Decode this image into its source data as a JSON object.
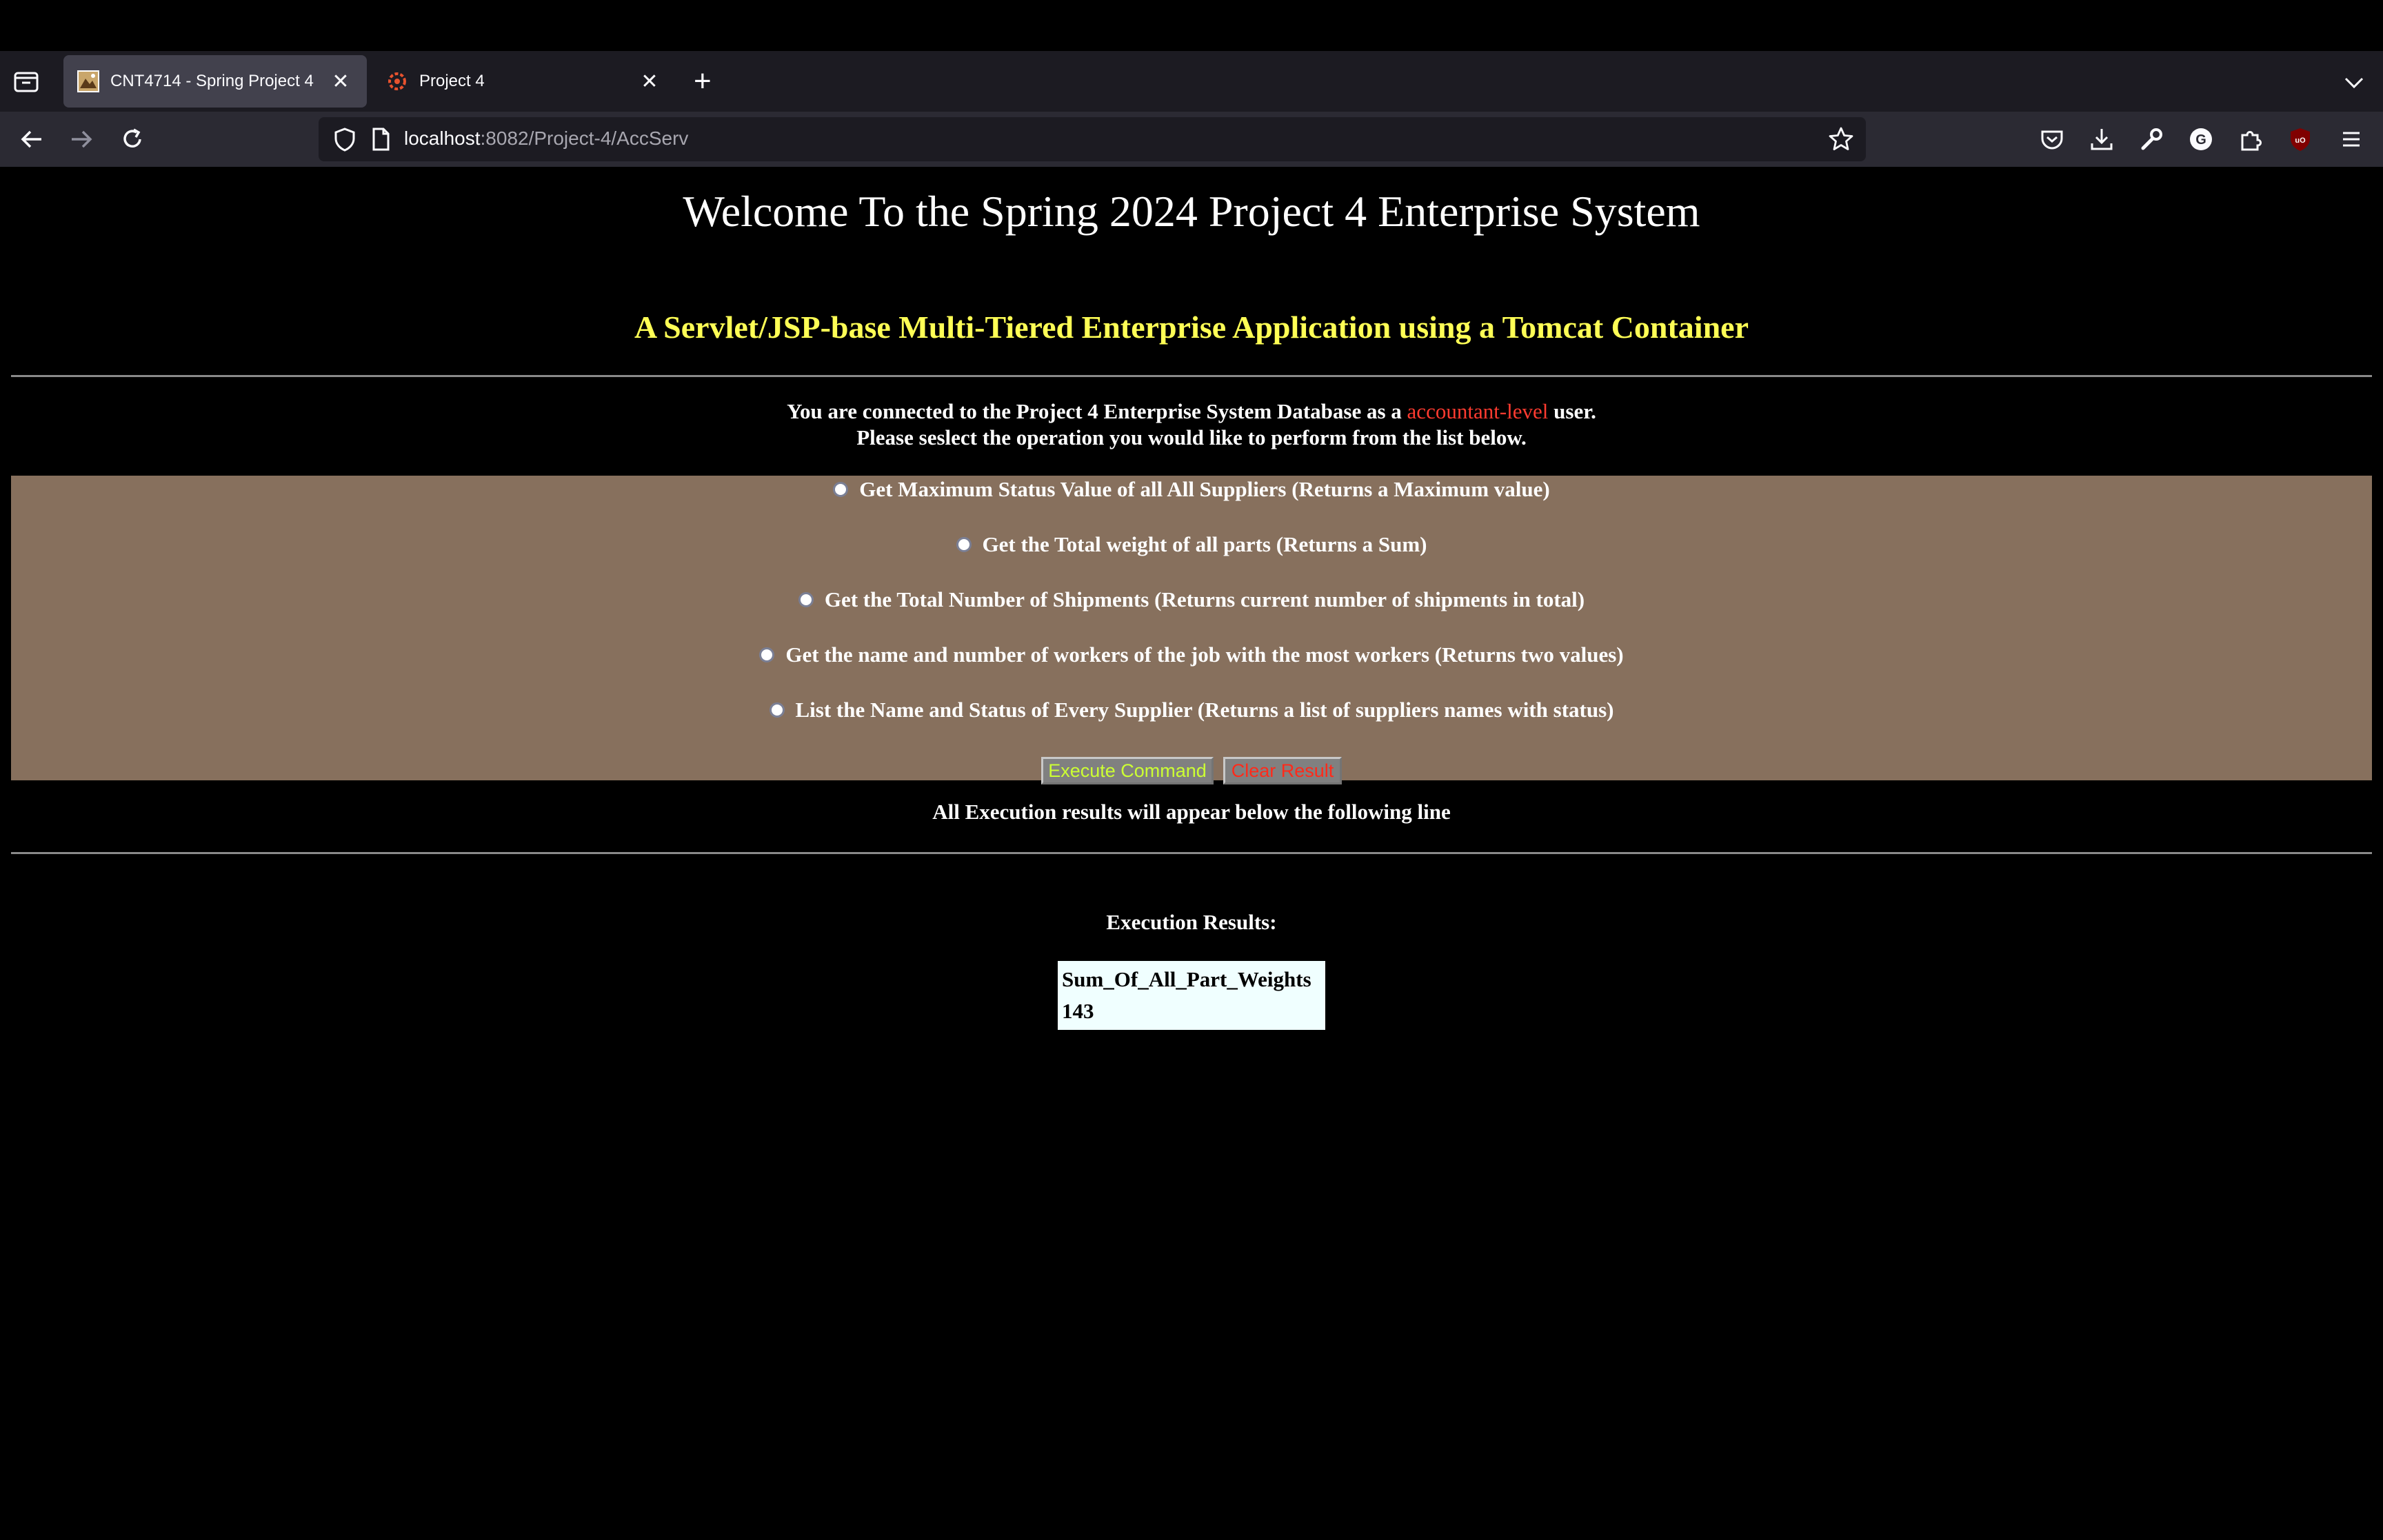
{
  "browser": {
    "tabs": [
      {
        "title": "CNT4714 - Spring Project 4",
        "active": true
      },
      {
        "title": "Project 4",
        "active": false
      }
    ],
    "url": {
      "host": "localhost",
      "rest": ":8082/Project-4/AccServ"
    }
  },
  "page": {
    "heading": "Welcome To the Spring 2024 Project 4 Enterprise System",
    "subheading": "A Servlet/JSP-base Multi-Tiered Enterprise Application using a Tomcat Container",
    "info": {
      "prefix": "You are connected to the Project 4 Enterprise System Database as a ",
      "role": "accountant-level",
      "suffix": " user.",
      "line2": "Please seslect the operation you would like to perform from the list below."
    },
    "options": [
      "Get Maximum Status Value of all All Suppliers (Returns a Maximum value)",
      "Get the Total weight of all parts (Returns a Sum)",
      "Get the Total Number of Shipments (Returns current number of shipments in total)",
      "Get the name and number of workers of the job with the most workers (Returns two values)",
      "List the Name and Status of Every Supplier (Returns a list of suppliers names with status)"
    ],
    "buttons": {
      "execute": "Execute Command",
      "clear": "Clear Result"
    },
    "results_note": "All Execution results will appear below the following line",
    "results_title": "Execution Results:",
    "result": {
      "column": "Sum_Of_All_Part_Weights",
      "value": "143"
    }
  },
  "colors": {
    "subheading": "#ffff55",
    "role": "#ff3b30",
    "options_bg": "#87705d",
    "execute_text": "#ccff33",
    "clear_text": "#ff2a1a",
    "result_bg": "#f0ffff"
  }
}
